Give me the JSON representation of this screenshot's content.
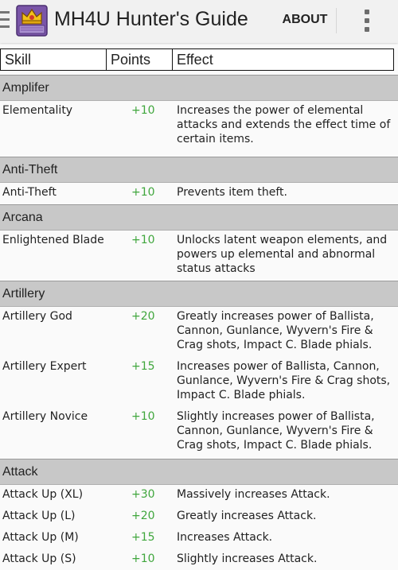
{
  "app": {
    "title": "MH4U Hunter's Guide",
    "about_label": "ABOUT",
    "accent_points_color": "#3fa63c"
  },
  "columns": [
    "Skill",
    "Points",
    "Effect"
  ],
  "groups": [
    {
      "name": "Amplifer",
      "rows": [
        {
          "skill": "Elementality",
          "points": "+10",
          "effect": "Increases the power of elemental attacks and extends the effect time of certain items."
        }
      ]
    },
    {
      "name": "Anti-Theft",
      "rows": [
        {
          "skill": "Anti-Theft",
          "points": "+10",
          "effect": "Prevents item theft."
        }
      ]
    },
    {
      "name": "Arcana",
      "rows": [
        {
          "skill": "Enlightened Blade",
          "points": "+10",
          "effect": "Unlocks latent weapon elements, and powers up elemental and abnormal status attacks"
        }
      ]
    },
    {
      "name": "Artillery",
      "rows": [
        {
          "skill": "Artillery God",
          "points": "+20",
          "effect": "Greatly increases power of Ballista, Cannon, Gunlance, Wyvern's Fire & Crag shots, Impact C. Blade phials."
        },
        {
          "skill": "Artillery Expert",
          "points": "+15",
          "effect": "Increases power of Ballista, Cannon, Gunlance, Wyvern's Fire & Crag shots, Impact C. Blade phials."
        },
        {
          "skill": "Artillery Novice",
          "points": "+10",
          "effect": "Slightly increases power of Ballista, Cannon, Gunlance, Wyvern's Fire & Crag shots, Impact C. Blade phials."
        }
      ]
    },
    {
      "name": "Attack",
      "rows": [
        {
          "skill": "Attack Up (XL)",
          "points": "+30",
          "effect": "Massively increases Attack."
        },
        {
          "skill": "Attack Up (L)",
          "points": "+20",
          "effect": "Greatly increases Attack."
        },
        {
          "skill": "Attack Up (M)",
          "points": "+15",
          "effect": "Increases Attack."
        },
        {
          "skill": "Attack Up (S)",
          "points": "+10",
          "effect": "Slightly increases Attack."
        }
      ]
    }
  ]
}
